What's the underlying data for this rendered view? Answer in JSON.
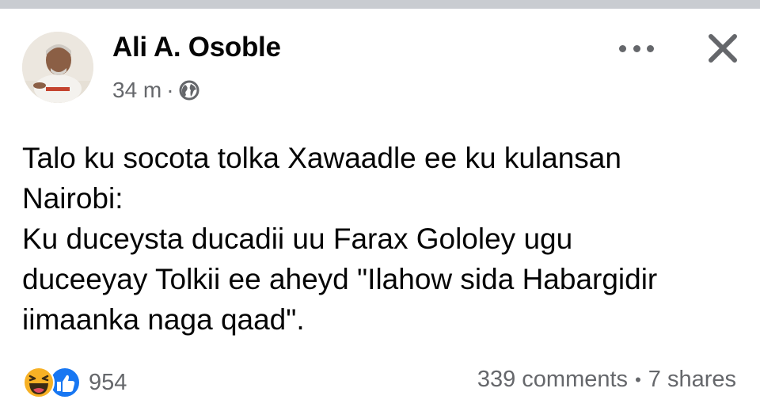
{
  "post": {
    "author": "Ali A. Osoble",
    "time": "34 m",
    "separator": "·",
    "privacy_icon": "globe-icon",
    "text_lines": [
      "Talo ku socota tolka Xawaadle ee ku kulansan",
      "Nairobi:",
      "Ku duceysta ducadii uu Farax Gololey ugu",
      "duceeyay Tolkii ee aheyd \"Ilahow sida Habargidir",
      "iimaanka naga qaad\"."
    ]
  },
  "actions": {
    "more_icon": "more-options-icon",
    "close_icon": "close-icon"
  },
  "footer": {
    "reaction_icons": [
      "haha-icon",
      "like-icon"
    ],
    "reaction_count": "954",
    "comments": "339 comments",
    "dot": "•",
    "shares": "7 shares"
  },
  "colors": {
    "text": "#050505",
    "secondary": "#65676b",
    "like_blue": "#1877f2",
    "haha_yellow": "#f7b125",
    "top_bar": "#c9ccd1"
  }
}
